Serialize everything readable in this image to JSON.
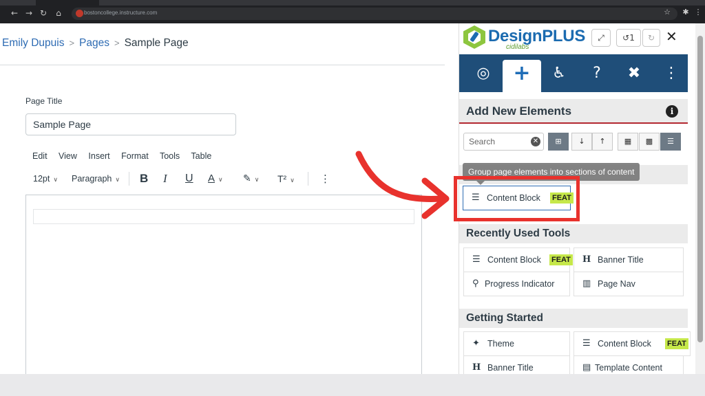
{
  "browser": {
    "url": "bostoncollege.instructure.com"
  },
  "breadcrumb": {
    "items": [
      "Emily Dupuis",
      "Pages",
      "Sample Page"
    ]
  },
  "editor": {
    "title_label": "Page Title",
    "title_value": "Sample Page",
    "menu": [
      "Edit",
      "View",
      "Insert",
      "Format",
      "Tools",
      "Table"
    ],
    "font_size": "12pt",
    "block_format": "Paragraph",
    "superscript_label": "T²"
  },
  "panel": {
    "logo_name": "DesignPLUS",
    "logo_sub": "cidilabs",
    "undo_count": "1",
    "section_title": "Add New Elements",
    "search_placeholder": "Search",
    "tooltip": "Group page elements into sections of content",
    "highlighted": {
      "label": "Content Block",
      "badge": "FEAT"
    },
    "recent_title": "Recently Used Tools",
    "recent": [
      {
        "label": "Content Block",
        "badge": "FEAT",
        "icon": "list-icon"
      },
      {
        "label": "Banner Title",
        "badge": "",
        "icon": "heading-icon"
      },
      {
        "label": "Progress Indicator",
        "badge": "",
        "icon": "map-pin-icon"
      },
      {
        "label": "Page Nav",
        "badge": "",
        "icon": "book-icon"
      }
    ],
    "started_title": "Getting Started",
    "started": [
      {
        "label": "Theme",
        "badge": "",
        "icon": "magic-wand-icon"
      },
      {
        "label": "Content Block",
        "badge": "FEAT",
        "icon": "list-icon"
      },
      {
        "label": "Banner Title",
        "badge": "",
        "icon": "heading-icon"
      },
      {
        "label": "Template Content",
        "badge": "",
        "icon": "file-icon"
      }
    ]
  },
  "colors": {
    "annotation": "#e8322d",
    "nav_bg": "#1f4e79",
    "feat_badge": "#c6e84a",
    "link": "#2d6bb3"
  }
}
